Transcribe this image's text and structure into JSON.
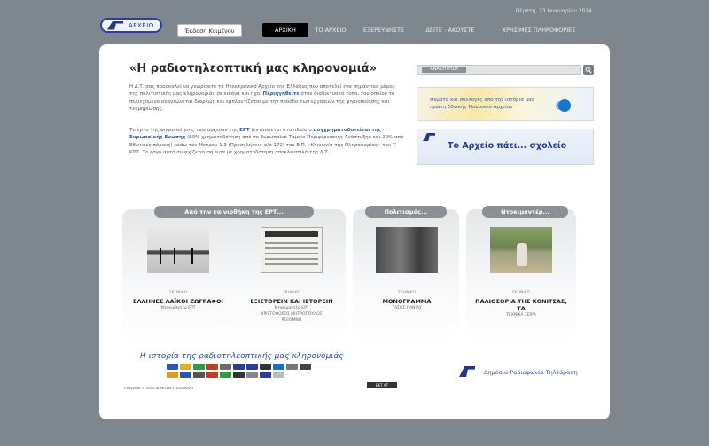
{
  "header": {
    "date": "Πέμπτη, 23 Ιανουαρίου 2014",
    "logo_text": "ΑΡΧΕΙΟ",
    "text_button": "Έκδοση Κειμένου",
    "nav": [
      {
        "label": "ΑΡΧΙΚΗ",
        "active": true
      },
      {
        "label": "ΤΟ ΑΡΧΕΙΟ",
        "active": false
      },
      {
        "label": "ΕΞΕΡΕΥΝΗΣΤΕ",
        "active": false
      },
      {
        "label": "ΔΕΙΤΕ - ΑΚΟΥΣΤΕ",
        "active": false
      },
      {
        "label": "ΧΡΗΣΙΜΕΣ ΠΛΗΡΟΦΟΡΙΕΣ",
        "active": false
      }
    ]
  },
  "intro": {
    "title": "«Η ραδιοτηλεοπτική μας κληρονομιά»",
    "p1_lead": "Η Δ.Τ. σας προσκαλεί να γνωρίσετε το Ηλεκτρονικό Αρχείο της Ελλάδας που αποτελεί ένα σημαντικό μέρος της πολιτιστικής μας κληρονομιάς σε εικόνα και ήχο.",
    "p1_blue": "Περιηγηθείτε",
    "p1_tail": "στον διαδικτυακό τόπο, του οποίου το περιεχόμενο ανανεώνεται διαρκώς και εμπλουτίζεται με την πρόοδο των εργασιών της ψηφιοποίησης και τεκμηρίωσης.",
    "p2_a": "Το έργο της ψηφιοποίησης των αρχείων της",
    "p2_blue1": "ΕΡΤ",
    "p2_b": "(εντάσσεται στο πλαίσιο",
    "p2_blue2": "συγχρηματοδοτείται της Ευρωπαϊκής Ενωσης",
    "p2_c": "(80% χρηματοδότηση από το Ευρωπαϊκό Ταμείο Περιφερειακής Ανάπτυξης και 20% από Εθνικούς πόρους) μέσω του Μέτρου 1.3 (Προσκλήσεις α/α 172) του Ε.Π. «Κοινωνία της Πληροφορίας» του Γ' ΚΠΣ. Το έργο αυτό συνεχίζεται σήμερα με χρηματοδότηση αποκλειστικά της Δ.Τ."
  },
  "search": {
    "label": "ΑΝΑΖΗΤΗΣΗ"
  },
  "promos": {
    "promo1_line1": "Θέματα και συλλογές από την ιστορία μας",
    "promo1_line2": "πρώτη Εθνικής Μουσικού Αρχείου",
    "promo2": "Το Αρχείο πάει... σχολείο"
  },
  "sections": [
    {
      "title": "Από την ταινιοθήκη της ΕΡΤ..."
    },
    {
      "title": "Πολιτισμός..."
    },
    {
      "title": "Ντοκιμαντέρ..."
    }
  ],
  "cards": [
    {
      "category": "ΣΚΗΝΙΚΟ",
      "title": "ΕΛΛΗΝΕΣ ΛΑΪΚΟΙ ΖΩΓΡΑΦΟΙ",
      "sub": [
        "Ντοκιμαντέρ ΕΡΤ"
      ]
    },
    {
      "category": "ΣΚΗΝΙΚΟ",
      "title": "ΕΞΙΣΤΟΡΕΙΝ ΚΑΙ ΙΣΤΟΡΕΙΝ",
      "sub": [
        "Ντοκιμαντέρ ΕΡΤ",
        "ΧΡΙΣΤΟΦΟΡΟΣ ΜΗΤΡΟΠΟΥΛΟΣ",
        "ΡΕΘΥΜΝΟ"
      ]
    },
    {
      "category": "ΣΚΗΝΙΚΟ",
      "title": "ΜΟΝΟΓΡΑΜΜΑ",
      "sub": [
        "ΤΑΣΟΣ ΠΑΝΙΑΣ"
      ]
    },
    {
      "category": "ΣΚΗΝΙΚΟ",
      "title": "ΠΑΛΙΟΣΟΡΙΑ ΤΗΣ ΚΟΝΙΤΣΑΣ, ΤΑ",
      "sub": [
        "ΤΕΧΝΙΚΑ ΣΕΙΡΑ"
      ]
    }
  ],
  "footer": {
    "slogan": "Η ιστορία της ραδιοτηλεοπτικής μας κληρονομιάς",
    "copyright": "Copyright © 2014 ΔΗΜΟΣΙΑ ΤΗΛΕΟΡΑΣΗ",
    "badge": "ΕΚΤ ΑΤ",
    "ert_name": "Δημόσια Ραδιοφωνία Τηλεόραση"
  },
  "colors": {
    "background": "#7d878d",
    "brand_blue": "#24368f",
    "nav_active": "#000000",
    "pill": "#8a9095"
  }
}
